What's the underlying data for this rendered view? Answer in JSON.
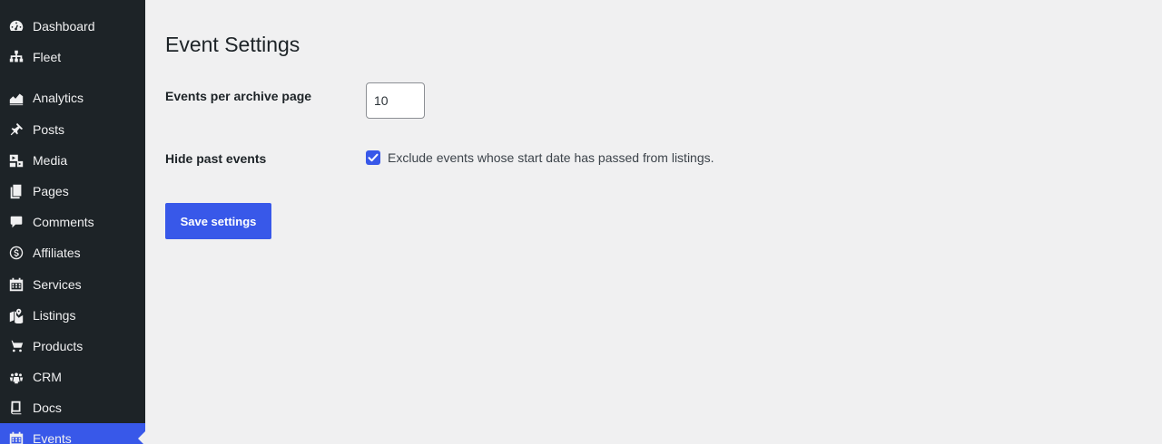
{
  "sidebar": {
    "items": [
      {
        "label": "Dashboard",
        "icon": "dashboard-icon"
      },
      {
        "label": "Fleet",
        "icon": "sitemap-icon"
      },
      {
        "label": "Analytics",
        "icon": "chart-area-icon"
      },
      {
        "label": "Posts",
        "icon": "pin-icon"
      },
      {
        "label": "Media",
        "icon": "media-icon"
      },
      {
        "label": "Pages",
        "icon": "pages-icon"
      },
      {
        "label": "Comments",
        "icon": "comment-icon"
      },
      {
        "label": "Affiliates",
        "icon": "dollar-icon"
      },
      {
        "label": "Services",
        "icon": "calendar-icon"
      },
      {
        "label": "Listings",
        "icon": "map-icon"
      },
      {
        "label": "Products",
        "icon": "cart-icon"
      },
      {
        "label": "CRM",
        "icon": "groups-icon"
      },
      {
        "label": "Docs",
        "icon": "book-icon"
      },
      {
        "label": "Events",
        "icon": "calendar-icon",
        "active": true
      }
    ]
  },
  "main": {
    "title": "Event Settings",
    "archive": {
      "label": "Events per archive page",
      "value": "10"
    },
    "hide_past": {
      "label": "Hide past events",
      "description": "Exclude events whose start date has passed from listings.",
      "checked": true
    },
    "save_label": "Save settings"
  },
  "colors": {
    "sidebar_bg": "#1d2327",
    "accent": "#3858e9",
    "page_bg": "#f0f0f1"
  }
}
